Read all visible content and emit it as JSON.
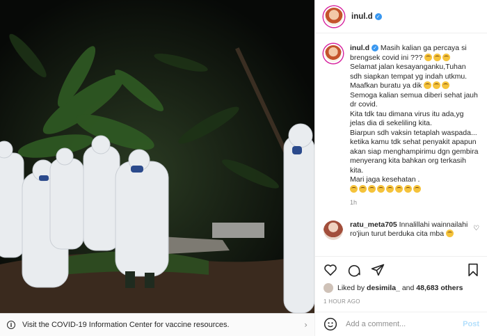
{
  "post": {
    "username": "inul.d",
    "caption_lines": [
      "Masih kalian ga percaya si brengsek covid ini ???",
      "Selamat jalan kesayanganku,Tuhan sdh siapkan tempat yg indah utkmu.",
      "Maafkan buratu ya dik",
      "Semoga kalian semua diberi sehat jauh dr covid.",
      "Kita tdk tau dimana virus itu ada,yg jelas dia di sekeliling kita.",
      "Biarpun sdh vaksin tetaplah waspada...",
      "ketika kamu tdk sehat penyakit apapun akan siap menghampirimu dgn gembira menyerang kita bahkan org terkasih kita.",
      "Mari jaga kesehatan ."
    ],
    "caption_time": "1h"
  },
  "comment": {
    "username": "ratu_meta705",
    "text": "Innalillahi wainnailahi ro'jiun turut berduka cita mba"
  },
  "likes": {
    "prefix": "Liked by",
    "user": "desimila_",
    "and": "and",
    "count": "48,683 others"
  },
  "posted_ago": "1 HOUR AGO",
  "add_comment": {
    "placeholder": "Add a comment...",
    "post_label": "Post"
  },
  "covid_bar": {
    "text": "Visit the COVID-19 Information Center for vaccine resources."
  },
  "icons": [
    "heart-icon",
    "comment-icon",
    "share-icon",
    "bookmark-icon",
    "emoji-icon",
    "info-icon",
    "chevron-right-icon",
    "verified-icon"
  ],
  "colors": {
    "accent": "#3897f0",
    "post_disabled": "#b2dffc",
    "muted": "#8e8e8e"
  }
}
